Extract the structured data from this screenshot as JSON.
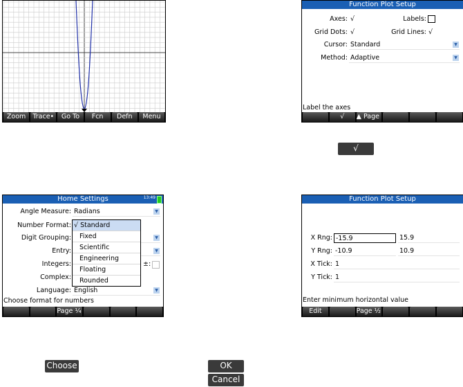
{
  "plot": {
    "softkeys": [
      "Zoom",
      "Trace•",
      "Go To",
      "Fcn",
      "Defn",
      "Menu"
    ]
  },
  "setup1": {
    "title": "Function Plot Setup",
    "axes_label": "Axes:",
    "axes_value": "√",
    "labels_label": "Labels:",
    "griddots_label": "Grid Dots:",
    "griddots_value": "√",
    "gridlines_label": "Grid Lines:",
    "gridlines_value": "√",
    "cursor_label": "Cursor:",
    "cursor_value": "Standard",
    "method_label": "Method:",
    "method_value": "Adaptive",
    "status": "Label the axes",
    "softkeys": [
      "",
      "√",
      "▲ Page ²⁄₂",
      "",
      "",
      ""
    ]
  },
  "home": {
    "title": "Home Settings",
    "clock": "13:49",
    "angle_label": "Angle Measure:",
    "angle_value": "Radians",
    "number_label": "Number Format:",
    "digit_label": "Digit Grouping:",
    "entry_label": "Entry:",
    "integers_label": "Integers:",
    "integers_partial": "±:",
    "complex_label": "Complex:",
    "language_label": "Language:",
    "language_value": "English",
    "status": "Choose format for numbers",
    "softkeys": [
      "",
      "",
      "Page ¹⁄₄ ▼",
      "",
      "",
      ""
    ],
    "popup_items": [
      "√ Standard",
      "Fixed",
      "Scientific",
      "Engineering",
      "Floating",
      "Rounded"
    ]
  },
  "setup2": {
    "title": "Function Plot Setup",
    "xrng_label": "X Rng:",
    "xrng_min": "-15.9",
    "xrng_max": "15.9",
    "yrng_label": "Y Rng:",
    "yrng_min": "-10.9",
    "yrng_max": "10.9",
    "xtick_label": "X Tick:",
    "xtick_value": "1",
    "ytick_label": "Y Tick:",
    "ytick_value": "1",
    "status": "Enter minimum horizontal value",
    "softkeys": [
      "Edit",
      "",
      "Page ¹⁄₂ ▼",
      "",
      "",
      ""
    ]
  },
  "keys": {
    "check": "√",
    "choose": "Choose",
    "ok": "OK",
    "cancel": "Cancel"
  }
}
